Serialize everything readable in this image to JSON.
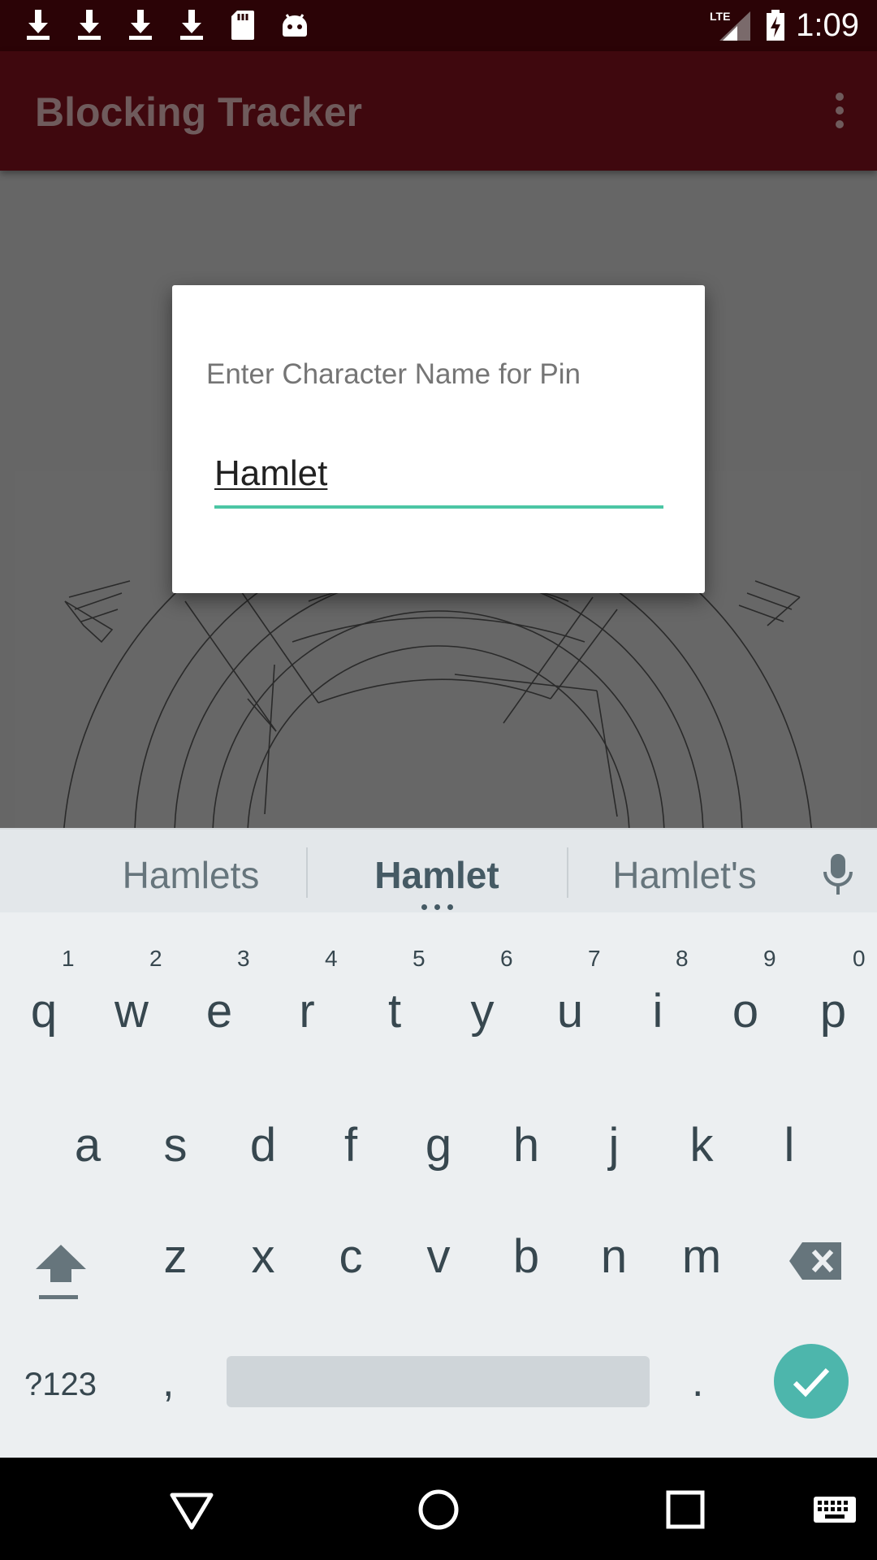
{
  "status_bar": {
    "icons": [
      "download-icon",
      "download-icon",
      "download-icon",
      "download-icon",
      "sd-card-icon",
      "android-debug-icon"
    ],
    "network": "LTE",
    "clock": "1:09"
  },
  "app_bar": {
    "title": "Blocking Tracker",
    "overflow_icon": "more-vert-icon"
  },
  "dialog": {
    "message": "Enter Character Name for Pin",
    "input_value": "Hamlet"
  },
  "keyboard": {
    "suggestions": [
      "Hamlets",
      "Hamlet",
      "Hamlet's"
    ],
    "row1": [
      {
        "key": "q",
        "hint": "1"
      },
      {
        "key": "w",
        "hint": "2"
      },
      {
        "key": "e",
        "hint": "3"
      },
      {
        "key": "r",
        "hint": "4"
      },
      {
        "key": "t",
        "hint": "5"
      },
      {
        "key": "y",
        "hint": "6"
      },
      {
        "key": "u",
        "hint": "7"
      },
      {
        "key": "i",
        "hint": "8"
      },
      {
        "key": "o",
        "hint": "9"
      },
      {
        "key": "p",
        "hint": "0"
      }
    ],
    "row2": [
      "a",
      "s",
      "d",
      "f",
      "g",
      "h",
      "j",
      "k",
      "l"
    ],
    "row3": [
      "z",
      "x",
      "c",
      "v",
      "b",
      "n",
      "m"
    ],
    "symbols_label": "?123",
    "comma": ",",
    "period": "."
  },
  "colors": {
    "status_bar": "#2b0306",
    "app_bar": "#3f080e",
    "accent": "#4cc6a4",
    "enter_key": "#4db6ac"
  },
  "nav_bar": {
    "icons": [
      "back-icon",
      "home-icon",
      "recents-icon",
      "keyboard-icon"
    ]
  }
}
